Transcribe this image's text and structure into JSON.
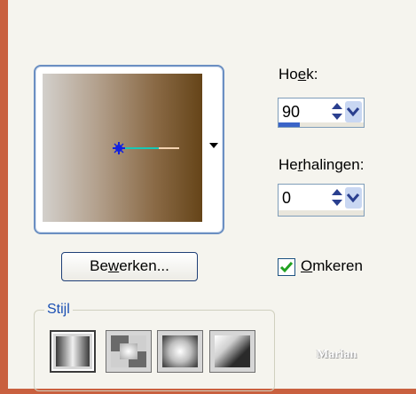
{
  "preview": {
    "gradient_colors": [
      "#d3d0cc",
      "#b29f8b",
      "#8a6a46",
      "#654418"
    ]
  },
  "angle": {
    "label_pre": "Ho",
    "label_key": "e",
    "label_post": "k:",
    "value": "90",
    "progress": 0.25
  },
  "repeats": {
    "label_pre": "He",
    "label_key": "r",
    "label_post": "halingen:",
    "value": "0"
  },
  "edit_button": {
    "label_pre": "Be",
    "label_key": "w",
    "label_post": "erken..."
  },
  "invert": {
    "checked": true,
    "label_key": "O",
    "label_post": "mkeren"
  },
  "style_group": {
    "legend": "Stijl",
    "options": [
      "linear",
      "rectangular",
      "radial",
      "corner"
    ]
  },
  "watermark": "Marian"
}
